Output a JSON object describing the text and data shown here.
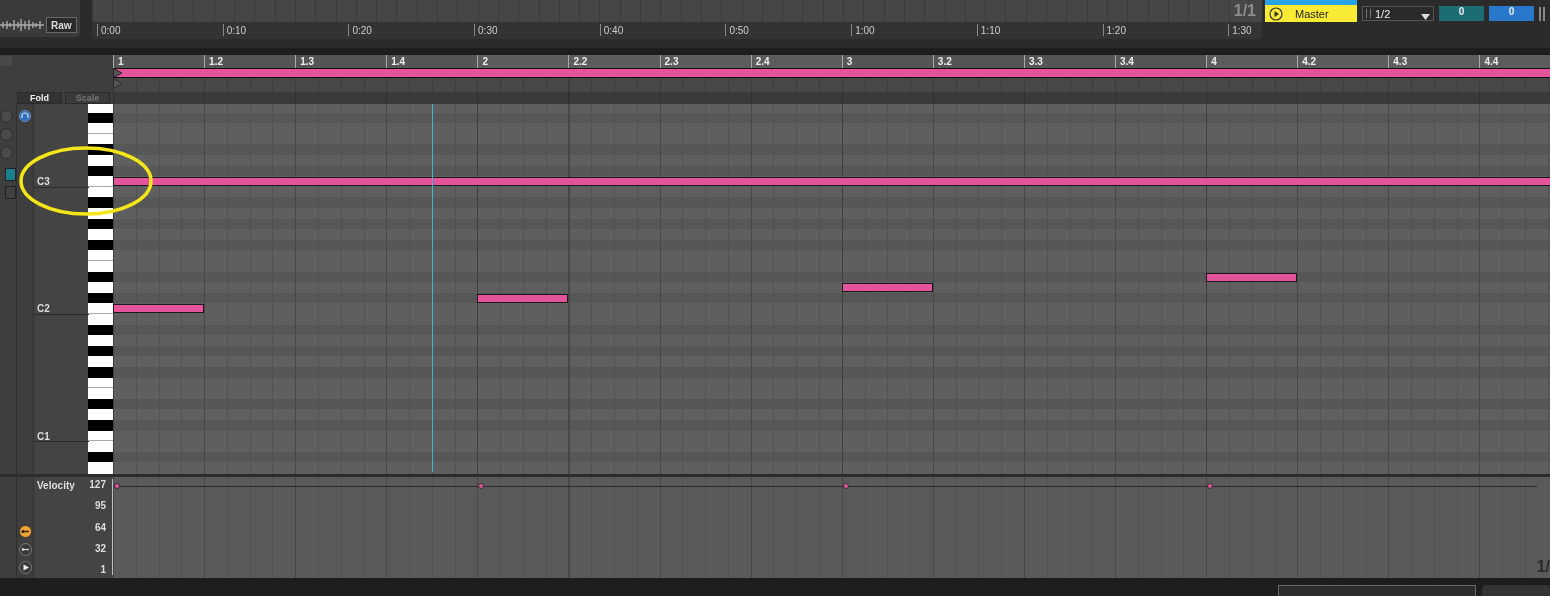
{
  "top_bar": {
    "raw_button": "Raw",
    "time_ruler": [
      "0:00",
      "0:10",
      "0:20",
      "0:30",
      "0:40",
      "0:50",
      "1:00",
      "1:10",
      "1:20",
      "1:30"
    ],
    "page_indicator": "1/1",
    "track_button": "Master",
    "quantize_dropdown": "1/2",
    "fields": [
      "0",
      "0"
    ]
  },
  "piano_roll": {
    "beat_ruler": [
      "1",
      "1.2",
      "1.3",
      "1.4",
      "2",
      "2.2",
      "2.3",
      "2.4",
      "3",
      "3.2",
      "3.3",
      "3.4",
      "4",
      "4.2",
      "4.3",
      "4.4"
    ],
    "fold_button": {
      "label": "Fold",
      "selected": true
    },
    "scale_button": {
      "label": "Scale",
      "selected": false
    },
    "octave_labels": [
      "C3",
      "C2",
      "C1"
    ],
    "velocity": {
      "label": "Velocity",
      "ticks": [
        "127",
        "95",
        "64",
        "32",
        "1"
      ]
    },
    "page_indicator": "1/"
  }
}
